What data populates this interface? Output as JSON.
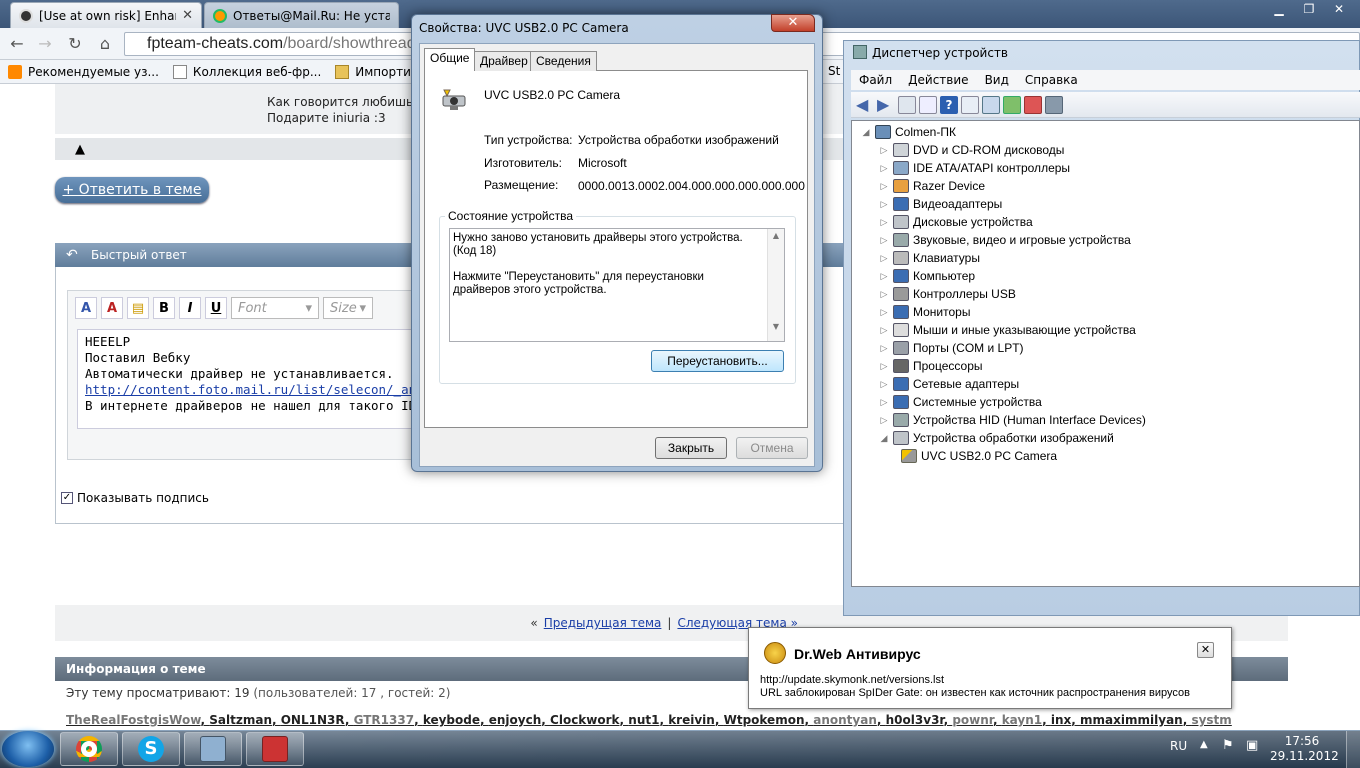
{
  "chrome": {
    "tabs": [
      {
        "title": "[Use at own risk] Enhance",
        "icon": "skull-icon"
      },
      {
        "title": "Ответы@Mail.Ru: Не уста",
        "icon": "mailru-icon"
      }
    ],
    "url_host": "fpteam-cheats.com",
    "url_path": "/board/showthread.",
    "bookmarks": [
      "Рекомендуемые уз...",
      "Коллекция веб-фр...",
      "Импортирован"
    ],
    "bookmark_tail": "St"
  },
  "forum": {
    "quote_lines": [
      "Как говорится любишь п",
      "Подарите iniuria :3"
    ],
    "reply_button": "+ Ответить в теме",
    "quick_reply_title": "Быстрый ответ",
    "editor": {
      "font_placeholder": "Font",
      "size_placeholder": "Size",
      "lines": [
        "HEEELP",
        "Поставил Вебку",
        "Автоматически драйвер не устанавливается.",
        "http://content.foto.mail.ru/list/selecon/_answers",
        "В интернете драйверов не нашел для такого ID"
      ]
    },
    "show_signature": "Показывать подпись",
    "prev_thread": "Предыдущая тема",
    "next_thread": "Следующая тема »",
    "nav_prefix": "«",
    "nav_sep": "|",
    "info_title": "Информация о теме",
    "viewers_text": "Эту тему просматривают: 19",
    "viewers_detail": "(пользователей: 17 , гостей: 2)",
    "users": [
      {
        "name": "TheRealFostgisWow",
        "gray": true
      },
      {
        "name": "Saltzman",
        "gray": false
      },
      {
        "name": "ONL1N3R",
        "gray": false
      },
      {
        "name": "GTR1337",
        "gray": true
      },
      {
        "name": "keybode",
        "gray": false
      },
      {
        "name": "enjoych",
        "gray": false
      },
      {
        "name": "Clockwork",
        "gray": false
      },
      {
        "name": "nut1",
        "gray": false
      },
      {
        "name": "kreivin",
        "gray": false
      },
      {
        "name": "Wtpokemon",
        "gray": false
      },
      {
        "name": "anontyan",
        "gray": true
      },
      {
        "name": "h0ol3v3r",
        "gray": false
      },
      {
        "name": "pownr",
        "gray": true
      },
      {
        "name": "kayn1",
        "gray": true
      },
      {
        "name": "inx",
        "gray": false
      },
      {
        "name": "mmaximmilyan",
        "gray": false
      },
      {
        "name": "systm",
        "gray": true
      }
    ]
  },
  "props_dialog": {
    "title": "Свойства: UVC USB2.0 PC Camera",
    "tabs": [
      "Общие",
      "Драйвер",
      "Сведения"
    ],
    "device_name": "UVC USB2.0 PC Camera",
    "fields": [
      {
        "label": "Тип устройства:",
        "value": "Устройства обработки изображений"
      },
      {
        "label": "Изготовитель:",
        "value": "Microsoft"
      },
      {
        "label": "Размещение:",
        "value": "0000.0013.0002.004.000.000.000.000.000"
      }
    ],
    "status_group": "Состояние устройства",
    "status_text_1": "Нужно заново установить драйверы этого устройства. (Код 18)",
    "status_text_2": "Нажмите \"Переустановить\" для переустановки драйверов этого устройства.",
    "reinstall_button": "Переустановить...",
    "ok_button": "Закрыть",
    "cancel_button": "Отмена"
  },
  "device_manager": {
    "title": "Диспетчер устройств",
    "menu": [
      "Файл",
      "Действие",
      "Вид",
      "Справка"
    ],
    "root": "Colmen-ПК",
    "items": [
      "DVD и CD-ROM дисководы",
      "IDE ATA/ATAPI контроллеры",
      "Razer Device",
      "Видеоадаптеры",
      "Дисковые устройства",
      "Звуковые, видео и игровые устройства",
      "Клавиатуры",
      "Компьютер",
      "Контроллеры USB",
      "Мониторы",
      "Мыши и иные указывающие устройства",
      "Порты (COM и LPT)",
      "Процессоры",
      "Сетевые адаптеры",
      "Системные устройства",
      "Устройства HID (Human Interface Devices)",
      "Устройства обработки изображений"
    ],
    "child": "UVC USB2.0 PC Camera"
  },
  "drweb": {
    "title": "Dr.Web Антивирус",
    "url": "http://update.skymonk.net/versions.lst",
    "message": "URL заблокирован SpIDer Gate: он известен как источник распространения вирусов"
  },
  "taskbar": {
    "lang": "RU",
    "time": "17:56",
    "date": "29.11.2012"
  }
}
